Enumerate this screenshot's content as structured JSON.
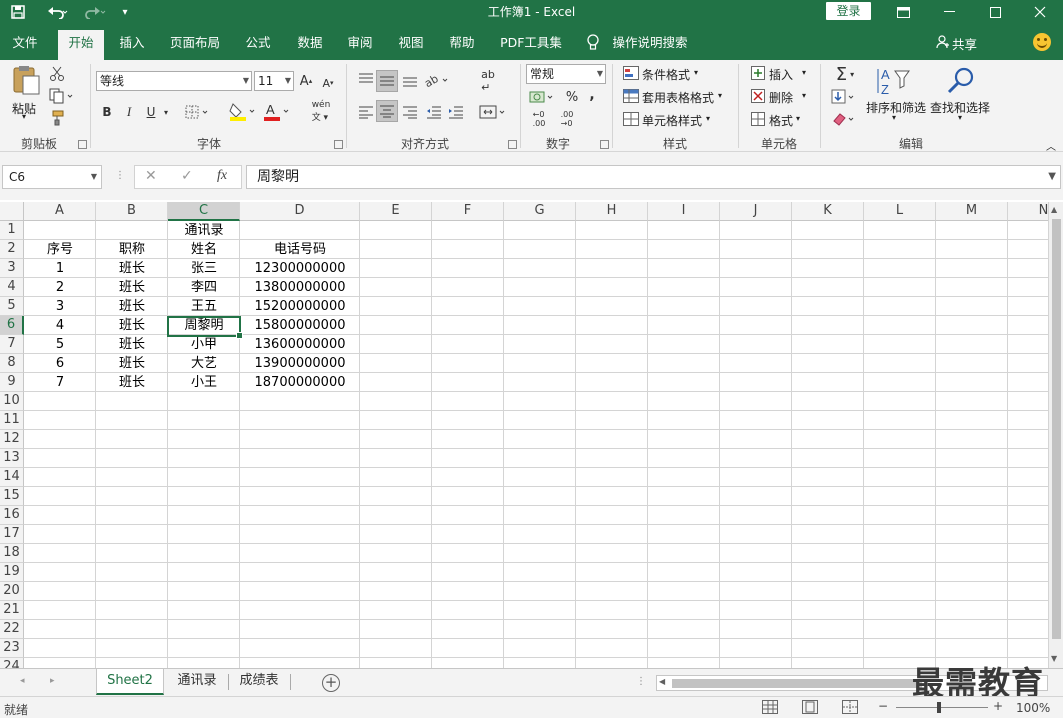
{
  "titlebar": {
    "title": "工作簿1  -  Excel",
    "login_label": "登录",
    "save_icon": "save-icon",
    "undo_icon": "undo-icon",
    "redo_icon": "redo-icon"
  },
  "tabs": [
    "文件",
    "开始",
    "插入",
    "页面布局",
    "公式",
    "数据",
    "审阅",
    "视图",
    "帮助",
    "PDF工具集",
    "操作说明搜索"
  ],
  "active_tab": "开始",
  "share_label": "共享",
  "ribbon": {
    "clipboard": {
      "paste_label": "粘贴",
      "group_label": "剪贴板"
    },
    "font": {
      "font_name": "等线",
      "font_size": "11",
      "group_label": "字体",
      "bold": "B",
      "italic": "I",
      "underline": "U"
    },
    "alignment": {
      "group_label": "对齐方式"
    },
    "number": {
      "format": "常规",
      "group_label": "数字",
      "percent": "%",
      "comma": ","
    },
    "styles": {
      "conditional": "条件格式",
      "table": "套用表格格式",
      "cell_styles": "单元格样式",
      "group_label": "样式"
    },
    "cells": {
      "insert": "插入",
      "delete": "删除",
      "format": "格式",
      "group_label": "单元格"
    },
    "editing": {
      "sort_filter": "排序和筛选",
      "find_select": "查找和选择",
      "group_label": "编辑"
    }
  },
  "formula_bar": {
    "name_box": "C6",
    "formula": "周黎明",
    "cancel": "✕",
    "enter": "✓",
    "fx": "fx"
  },
  "columns": [
    "A",
    "B",
    "C",
    "D",
    "E",
    "F",
    "G",
    "H",
    "I",
    "J",
    "K",
    "L",
    "M",
    "N"
  ],
  "selected_column": "C",
  "rows": [
    "1",
    "2",
    "3",
    "4",
    "5",
    "6",
    "7",
    "8",
    "9",
    "10",
    "11",
    "12",
    "13",
    "14",
    "15",
    "16",
    "17",
    "18",
    "19",
    "20",
    "21",
    "22",
    "23",
    "24"
  ],
  "selected_row": "6",
  "sheet": {
    "title": "通讯录",
    "headers": [
      "序号",
      "职称",
      "姓名",
      "电话号码"
    ],
    "records": [
      [
        "1",
        "班长",
        "张三",
        "12300000000"
      ],
      [
        "2",
        "班长",
        "李四",
        "13800000000"
      ],
      [
        "3",
        "班长",
        "王五",
        "15200000000"
      ],
      [
        "4",
        "班长",
        "周黎明",
        "15800000000"
      ],
      [
        "5",
        "班长",
        "小甲",
        "13600000000"
      ],
      [
        "6",
        "班长",
        "大艺",
        "13900000000"
      ],
      [
        "7",
        "班长",
        "小王",
        "18700000000"
      ]
    ]
  },
  "sheet_tabs": [
    "Sheet2",
    "通讯录",
    "成绩表"
  ],
  "active_sheet": "Sheet2",
  "status": {
    "ready": "就绪",
    "zoom": "100%"
  },
  "watermark": "最需教育"
}
